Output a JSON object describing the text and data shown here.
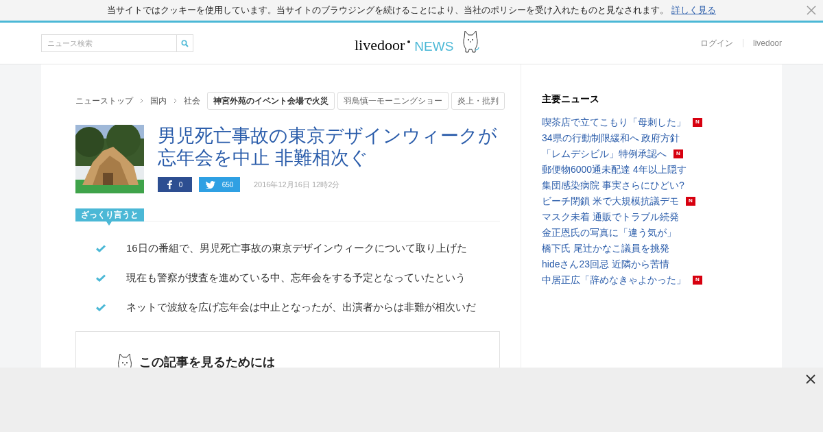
{
  "cookie_bar": {
    "message": "当サイトではクッキーを使用しています。当サイトのブラウジングを続けることにより、当社のポリシーを受け入れたものと見なされます。",
    "link": "詳しく見る"
  },
  "header": {
    "search": {
      "placeholder": "ニュース検索"
    },
    "logo": {
      "brand": "livedoor",
      "product": "NEWS"
    },
    "links": [
      "ログイン",
      "livedoor"
    ]
  },
  "breadcrumbs": [
    "ニューストップ",
    "国内",
    "社会"
  ],
  "tags": [
    {
      "label": "神宮外苑のイベント会場で火災",
      "featured": true
    },
    {
      "label": "羽鳥慎一モーニングショー",
      "featured": false
    },
    {
      "label": "炎上・批判",
      "featured": false
    }
  ],
  "article": {
    "title": "男児死亡事故の東京デザインウィークが忘年会を中止 非難相次ぐ",
    "facebook_count": "0",
    "twitter_count": "650",
    "date": "2016年12月16日 12時2分",
    "summary_label": "ざっくり言うと",
    "summary": [
      "16日の番組で、男児死亡事故の東京デザインウィークについて取り上げた",
      "現在も警察が捜査を進めている中、忘年会をする予定となっていたという",
      "ネットで波紋を広げ忘年会は中止となったが、出演者からは非難が相次いだ"
    ],
    "notice_title": "この記事を見るためには"
  },
  "sidebar": {
    "title": "主要ニュース",
    "items": [
      {
        "text": "喫茶店で立てこもり「母刺した」",
        "badge": "N"
      },
      {
        "text": "34県の行動制限緩和へ 政府方針"
      },
      {
        "text": "「レムデシビル」特例承認へ",
        "badge": "N"
      },
      {
        "text": "郵便物6000通未配達 4年以上隠す"
      },
      {
        "text": "集団感染病院 事実さらにひどい?"
      },
      {
        "text": "ビーチ閉鎖 米で大規模抗議デモ",
        "badge": "N"
      },
      {
        "text": "マスク未着 通販でトラブル続発"
      },
      {
        "text": "金正恩氏の写真に「違う気が」"
      },
      {
        "text": "橋下氏 尾辻かなこ議員を挑発"
      },
      {
        "text": "hideさん23回忌 近隣から苦情"
      },
      {
        "text": "中居正広「辞めなきゃよかった」",
        "badge": "N"
      }
    ]
  }
}
